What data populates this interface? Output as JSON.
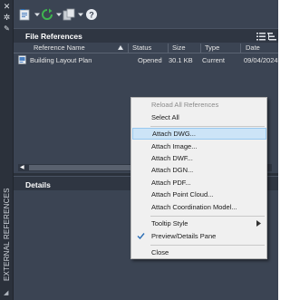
{
  "palette": "Dark Theme",
  "colors": {
    "panel_bg": "#3b4453",
    "header_bg": "#2f3642",
    "menu_bg": "#f0f0f0",
    "menu_highlight": "#cce4f7",
    "accent_blue": "#1f8fe0",
    "refresh_green": "#3fb34f"
  },
  "side_strip": {
    "title": "EXTERNAL REFERENCES",
    "icons": [
      "close-icon",
      "gear-icon",
      "wrench-icon"
    ]
  },
  "toolbar": {
    "buttons": [
      "attach-dwg-icon",
      "refresh-icon",
      "change-path-icon",
      "help-icon"
    ]
  },
  "file_references": {
    "title": "File References",
    "columns": [
      "Reference Name",
      "Status",
      "Size",
      "Type",
      "Date"
    ],
    "sorted_column": "Reference Name",
    "rows": [
      {
        "name": "Building Layout Plan",
        "status": "Opened",
        "size": "30.1 KB",
        "type": "Current",
        "date": "09/04/2024"
      }
    ]
  },
  "details": {
    "title": "Details"
  },
  "context_menu": {
    "items": [
      {
        "label": "Reload All References",
        "disabled": true
      },
      {
        "label": "Select All"
      },
      {
        "separator": true
      },
      {
        "label": "Attach DWG...",
        "highlighted": true
      },
      {
        "label": "Attach Image..."
      },
      {
        "label": "Attach DWF..."
      },
      {
        "label": "Attach DGN..."
      },
      {
        "label": "Attach PDF..."
      },
      {
        "label": "Attach Point Cloud..."
      },
      {
        "label": "Attach Coordination Model..."
      },
      {
        "separator": true
      },
      {
        "label": "Tooltip Style",
        "submenu": true
      },
      {
        "label": "Preview/Details Pane",
        "checked": true
      },
      {
        "separator": true
      },
      {
        "label": "Close"
      }
    ]
  }
}
